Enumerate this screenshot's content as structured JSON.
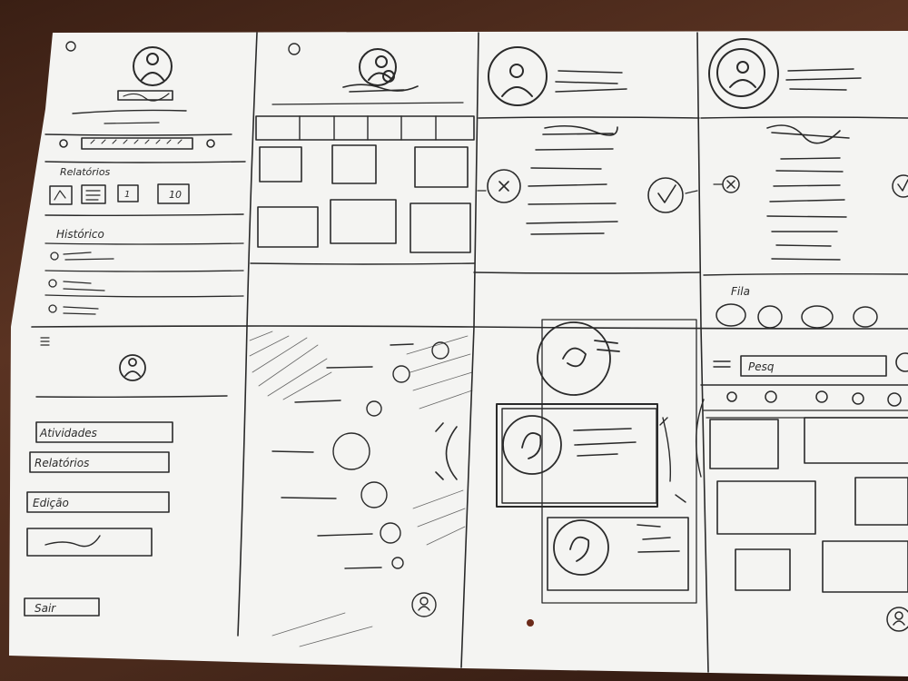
{
  "paper_color": "#f4f4f2",
  "table_color": "#4a2a1c",
  "ink_color": "#2a2a2a",
  "panel1": {
    "section_label": "Relatórios",
    "chips": [
      "1",
      "10"
    ],
    "history_label": "Histórico"
  },
  "menu": {
    "items": [
      "Atividades",
      "Relatórios",
      "Edição"
    ],
    "exit_label": "Sair"
  },
  "panel_detail": {
    "section_label": "Fila"
  },
  "search": {
    "value": "Pesq"
  }
}
